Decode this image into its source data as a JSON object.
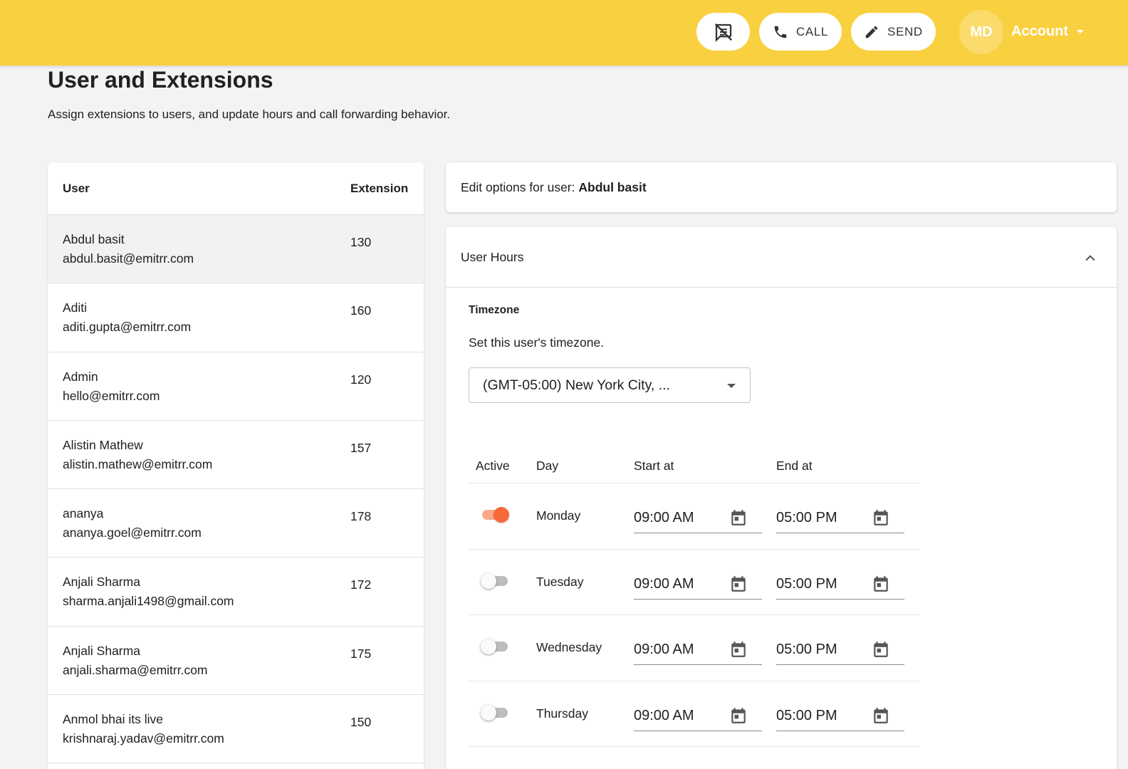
{
  "header": {
    "call_label": "CALL",
    "send_label": "SEND",
    "avatar_initials": "MD",
    "account_label": "Account"
  },
  "page": {
    "title": "User and Extensions",
    "subtitle": "Assign extensions to users, and update hours and call forwarding behavior."
  },
  "users_table": {
    "col_user": "User",
    "col_extension": "Extension",
    "rows": [
      {
        "name": "Abdul basit",
        "email": "abdul.basit@emitrr.com",
        "extension": "130"
      },
      {
        "name": "Aditi",
        "email": "aditi.gupta@emitrr.com",
        "extension": "160"
      },
      {
        "name": "Admin",
        "email": "hello@emitrr.com",
        "extension": "120"
      },
      {
        "name": "Alistin Mathew",
        "email": "alistin.mathew@emitrr.com",
        "extension": "157"
      },
      {
        "name": "ananya",
        "email": "ananya.goel@emitrr.com",
        "extension": "178"
      },
      {
        "name": "Anjali Sharma",
        "email": "sharma.anjali1498@gmail.com",
        "extension": "172"
      },
      {
        "name": "Anjali Sharma",
        "email": "anjali.sharma@emitrr.com",
        "extension": "175"
      },
      {
        "name": "Anmol bhai its live",
        "email": "krishnaraj.yadav@emitrr.com",
        "extension": "150"
      }
    ]
  },
  "edit": {
    "prefix": "Edit options for user: ",
    "user": "Abdul basit"
  },
  "user_hours": {
    "title": "User Hours",
    "timezone_label": "Timezone",
    "timezone_desc": "Set this user's timezone.",
    "timezone_value": "(GMT-05:00) New York City, ...",
    "col_active": "Active",
    "col_day": "Day",
    "col_start": "Start at",
    "col_end": "End at",
    "days": [
      {
        "day": "Monday",
        "active": true,
        "start": "09:00 AM",
        "end": "05:00 PM"
      },
      {
        "day": "Tuesday",
        "active": false,
        "start": "09:00 AM",
        "end": "05:00 PM"
      },
      {
        "day": "Wednesday",
        "active": false,
        "start": "09:00 AM",
        "end": "05:00 PM"
      },
      {
        "day": "Thursday",
        "active": false,
        "start": "09:00 AM",
        "end": "05:00 PM"
      }
    ]
  },
  "colors": {
    "topbar": "#f9d03f",
    "toggle_on": "#f7693b",
    "background": "#f3f3f5"
  }
}
